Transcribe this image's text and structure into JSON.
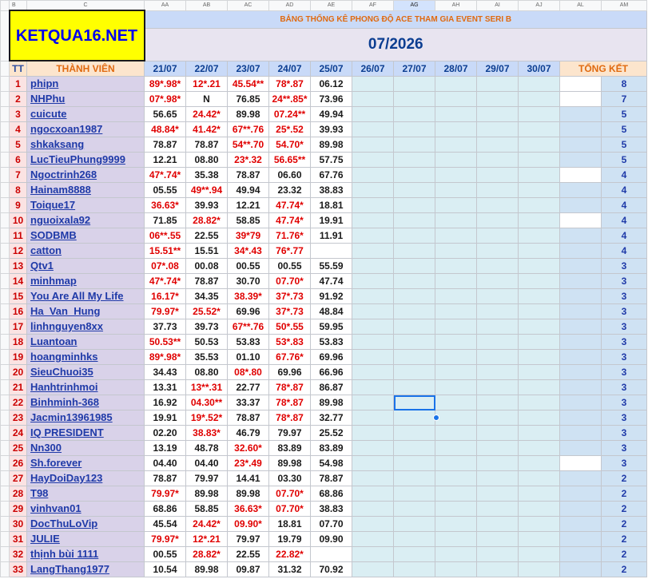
{
  "col_letters": [
    "B",
    "C",
    "AA",
    "AB",
    "AC",
    "AD",
    "AE",
    "AF",
    "AG",
    "AH",
    "AI",
    "AJ",
    "AL",
    "AM"
  ],
  "selected_col_letter": "AG",
  "logo": "KETQUA16.NET",
  "event_title": "BẢNG THỐNG KÊ PHONG ĐỘ ACE THAM GIA EVENT SERI B",
  "month": "07/2026",
  "headers": {
    "tt": "TT",
    "member": "THÀNH VIÊN",
    "dates": [
      "21/07",
      "22/07",
      "23/07",
      "24/07",
      "25/07",
      "26/07",
      "27/07",
      "28/07",
      "29/07",
      "30/07"
    ],
    "total": "TỔNG KẾT"
  },
  "rows": [
    {
      "tt": "1",
      "name": "phipn",
      "cells": [
        "89*.98*",
        "12*.21",
        "45.54**",
        "78*.87",
        "06.12"
      ],
      "red": [
        1,
        1,
        1,
        1,
        0
      ],
      "total": "8"
    },
    {
      "tt": "2",
      "name": "NHPhu",
      "cells": [
        "07*.98*",
        "N",
        "76.85",
        "24**.85*",
        "73.96"
      ],
      "red": [
        1,
        0,
        0,
        1,
        0
      ],
      "total": "7"
    },
    {
      "tt": "3",
      "name": "cuicute",
      "cells": [
        "56.65",
        "24.42*",
        "89.98",
        "07.24**",
        "49.94"
      ],
      "red": [
        0,
        1,
        0,
        1,
        0
      ],
      "total": "5"
    },
    {
      "tt": "4",
      "name": "ngocxoan1987",
      "cells": [
        "48.84*",
        "41.42*",
        "67**.76",
        "25*.52",
        "39.93"
      ],
      "red": [
        1,
        1,
        1,
        1,
        0
      ],
      "total": "5"
    },
    {
      "tt": "5",
      "name": "shkaksang",
      "cells": [
        "78.87",
        "78.87",
        "54**.70",
        "54.70*",
        "89.98"
      ],
      "red": [
        0,
        0,
        1,
        1,
        0
      ],
      "total": "5"
    },
    {
      "tt": "6",
      "name": "LucTieuPhung9999",
      "cells": [
        "12.21",
        "08.80",
        "23*.32",
        "56.65**",
        "57.75"
      ],
      "red": [
        0,
        0,
        1,
        1,
        0
      ],
      "total": "5"
    },
    {
      "tt": "7",
      "name": "Ngoctrinh268",
      "cells": [
        "47*.74*",
        "35.38",
        "78.87",
        "06.60",
        "67.76"
      ],
      "red": [
        1,
        0,
        0,
        0,
        0
      ],
      "total": "4"
    },
    {
      "tt": "8",
      "name": "Hainam8888",
      "cells": [
        "05.55",
        "49**.94",
        "49.94",
        "23.32",
        "38.83"
      ],
      "red": [
        0,
        1,
        0,
        0,
        0
      ],
      "total": "4"
    },
    {
      "tt": "9",
      "name": "Toique17",
      "cells": [
        "36.63*",
        "39.93",
        "12.21",
        "47.74*",
        "18.81"
      ],
      "red": [
        1,
        0,
        0,
        1,
        0
      ],
      "total": "4"
    },
    {
      "tt": "10",
      "name": "nguoixala92",
      "cells": [
        "71.85",
        "28.82*",
        "58.85",
        "47.74*",
        "19.91"
      ],
      "red": [
        0,
        1,
        0,
        1,
        0
      ],
      "total": "4"
    },
    {
      "tt": "11",
      "name": "SODBMB",
      "cells": [
        "06**.55",
        "22.55",
        "39*79",
        "71.76*",
        "11.91"
      ],
      "red": [
        1,
        0,
        1,
        1,
        0
      ],
      "total": "4"
    },
    {
      "tt": "12",
      "name": "catton",
      "cells": [
        "15.51**",
        "15.51",
        "34*.43",
        "76*.77",
        ""
      ],
      "red": [
        1,
        0,
        1,
        1,
        0
      ],
      "total": "4"
    },
    {
      "tt": "13",
      "name": "Qtv1",
      "cells": [
        "07*.08",
        "00.08",
        "00.55",
        "00.55",
        "55.59"
      ],
      "red": [
        1,
        0,
        0,
        0,
        0
      ],
      "total": "3"
    },
    {
      "tt": "14",
      "name": "minhmap",
      "cells": [
        "47*.74*",
        "78.87",
        "30.70",
        "07.70*",
        "47.74"
      ],
      "red": [
        1,
        0,
        0,
        1,
        0
      ],
      "total": "3"
    },
    {
      "tt": "15",
      "name": "You Are All My Life",
      "cells": [
        "16.17*",
        "34.35",
        "38.39*",
        "37*.73",
        "91.92"
      ],
      "red": [
        1,
        0,
        1,
        1,
        0
      ],
      "total": "3"
    },
    {
      "tt": "16",
      "name": "Ha_Van_Hung",
      "cells": [
        "79.97*",
        "25.52*",
        "69.96",
        "37*.73",
        "48.84"
      ],
      "red": [
        1,
        1,
        0,
        1,
        0
      ],
      "total": "3"
    },
    {
      "tt": "17",
      "name": "linhnguyen8xx",
      "cells": [
        "37.73",
        "39.73",
        "67**.76",
        "50*.55",
        "59.95"
      ],
      "red": [
        0,
        0,
        1,
        1,
        0
      ],
      "total": "3"
    },
    {
      "tt": "18",
      "name": "Luantoan",
      "cells": [
        "50.53**",
        "50.53",
        "53.83",
        "53*.83",
        "53.83"
      ],
      "red": [
        1,
        0,
        0,
        1,
        0
      ],
      "total": "3"
    },
    {
      "tt": "19",
      "name": "hoangminhks",
      "cells": [
        "89*.98*",
        "35.53",
        "01.10",
        "67.76*",
        "69.96"
      ],
      "red": [
        1,
        0,
        0,
        1,
        0
      ],
      "total": "3"
    },
    {
      "tt": "20",
      "name": "SieuChuoi35",
      "cells": [
        "34.43",
        "08.80",
        "08*.80",
        "69.96",
        "66.96"
      ],
      "red": [
        0,
        0,
        1,
        0,
        0
      ],
      "total": "3"
    },
    {
      "tt": "21",
      "name": "Hanhtrinhmoi",
      "cells": [
        "13.31",
        "13**.31",
        "22.77",
        "78*.87",
        "86.87"
      ],
      "red": [
        0,
        1,
        0,
        1,
        0
      ],
      "total": "3"
    },
    {
      "tt": "22",
      "name": "Binhminh-368",
      "cells": [
        "16.92",
        "04.30**",
        "33.37",
        "78*.87",
        "89.98"
      ],
      "red": [
        0,
        1,
        0,
        1,
        0
      ],
      "total": "3"
    },
    {
      "tt": "23",
      "name": "Jacmin13961985",
      "cells": [
        "19.91",
        "19*.52*",
        "78.87",
        "78*.87",
        "32.77"
      ],
      "red": [
        0,
        1,
        0,
        1,
        0
      ],
      "total": "3"
    },
    {
      "tt": "24",
      "name": "IQ PRESIDENT",
      "cells": [
        "02.20",
        "38.83*",
        "46.79",
        "79.97",
        "25.52"
      ],
      "red": [
        0,
        1,
        0,
        0,
        0
      ],
      "total": "3"
    },
    {
      "tt": "25",
      "name": "Nn300",
      "cells": [
        "13.19",
        "48.78",
        "32.60*",
        "83.89",
        "83.89"
      ],
      "red": [
        0,
        0,
        1,
        0,
        0
      ],
      "total": "3"
    },
    {
      "tt": "26",
      "name": "Sh.forever",
      "cells": [
        "04.40",
        "04.40",
        "23*.49",
        "89.98",
        "54.98"
      ],
      "red": [
        0,
        0,
        1,
        0,
        0
      ],
      "total": "3"
    },
    {
      "tt": "27",
      "name": "HayDoiDay123",
      "cells": [
        "78.87",
        "79.97",
        "14.41",
        "03.30",
        "78.87"
      ],
      "red": [
        0,
        0,
        0,
        0,
        0
      ],
      "total": "2"
    },
    {
      "tt": "28",
      "name": "T98",
      "cells": [
        "79.97*",
        "89.98",
        "89.98",
        "07.70*",
        "68.86"
      ],
      "red": [
        1,
        0,
        0,
        1,
        0
      ],
      "total": "2"
    },
    {
      "tt": "29",
      "name": "vinhvan01",
      "cells": [
        "68.86",
        "58.85",
        "36.63*",
        "07.70*",
        "38.83"
      ],
      "red": [
        0,
        0,
        1,
        1,
        0
      ],
      "total": "2"
    },
    {
      "tt": "30",
      "name": "DocThuLoVip",
      "cells": [
        "45.54",
        "24.42*",
        "09.90*",
        "18.81",
        "07.70"
      ],
      "red": [
        0,
        1,
        1,
        0,
        0
      ],
      "total": "2"
    },
    {
      "tt": "31",
      "name": "JULIE",
      "cells": [
        "79.97*",
        "12*.21",
        "79.97",
        "19.79",
        "09.90"
      ],
      "red": [
        1,
        1,
        0,
        0,
        0
      ],
      "total": "2"
    },
    {
      "tt": "32",
      "name": "thịnh bùi 1111",
      "cells": [
        "00.55",
        "28.82*",
        "22.55",
        "22.82*",
        ""
      ],
      "red": [
        0,
        1,
        0,
        1,
        0
      ],
      "total": "2"
    },
    {
      "tt": "33",
      "name": "LangThang1977",
      "cells": [
        "10.54",
        "89.98",
        "09.87",
        "31.32",
        "70.92"
      ],
      "red": [
        0,
        0,
        0,
        0,
        0
      ],
      "total": "2"
    }
  ],
  "white_total_rows": [
    1,
    2,
    7,
    10,
    26
  ]
}
